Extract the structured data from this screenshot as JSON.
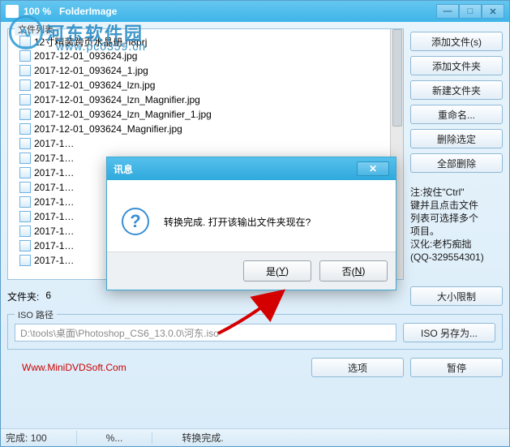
{
  "titlebar": {
    "percent": "100 %",
    "appname": "FolderImage"
  },
  "watermark": {
    "brand": "河东软件园",
    "url": "www.pc0359.cn"
  },
  "filelist": {
    "label": "文件列表",
    "items": [
      "12寸精装跨页水晶册.n8prj",
      "2017-12-01_093624.jpg",
      "2017-12-01_093624_1.jpg",
      "2017-12-01_093624_lzn.jpg",
      "2017-12-01_093624_lzn_Magnifier.jpg",
      "2017-12-01_093624_lzn_Magnifier_1.jpg",
      "2017-12-01_093624_Magnifier.jpg",
      "2017-1…",
      "2017-1…",
      "2017-1…",
      "2017-1…",
      "2017-1…",
      "2017-1…",
      "2017-1…",
      "2017-1…",
      "2017-1…"
    ]
  },
  "buttons": {
    "addFiles": "添加文件(s)",
    "addFolder": "添加文件夹",
    "newFolder": "新建文件夹",
    "rename": "重命名...",
    "deleteSel": "删除选定",
    "deleteAll": "全部删除",
    "sizeLimit": "大小限制",
    "isoSaveAs": "ISO 另存为...",
    "options": "选项",
    "pause": "暂停"
  },
  "tip": {
    "l1": "注:按住\"Ctrl\"",
    "l2": "键并且点击文件",
    "l3": "列表可选择多个",
    "l4": "项目。",
    "l5": "汉化:老朽痴拙",
    "l6": "(QQ-329554301)"
  },
  "folders": {
    "label": "文件夹:",
    "value": "6"
  },
  "iso": {
    "label": "ISO 路径",
    "path": "D:\\tools\\桌面\\Photoshop_CS6_13.0.0\\河东.iso"
  },
  "footerUrl": "Www.MiniDVDSoft.Com",
  "status": {
    "done": "完成:",
    "pct": "100",
    "pctLabel": "%...",
    "msg": "转换完成."
  },
  "modal": {
    "title": "讯息",
    "message": "转换完成. 打开该输出文件夹现在?",
    "yes": "是(",
    "yesKey": "Y",
    "yesEnd": ")",
    "no": "否(",
    "noKey": "N",
    "noEnd": ")"
  }
}
